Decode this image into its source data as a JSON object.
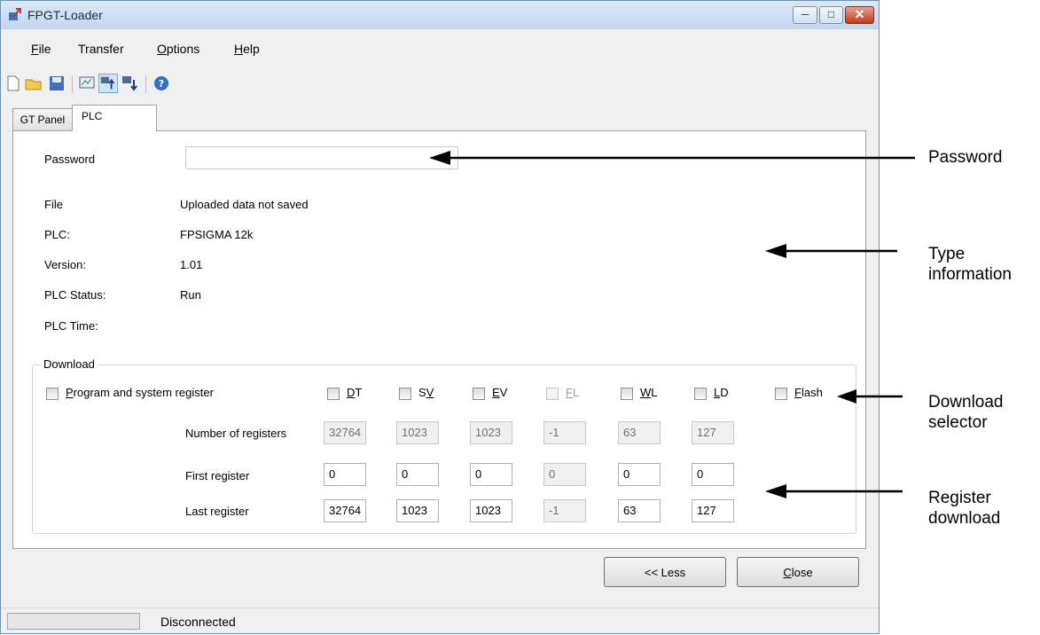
{
  "window": {
    "title": "FPGT-Loader"
  },
  "menu": [
    {
      "prefix": "",
      "accel": "F",
      "rest": "ile"
    },
    {
      "prefix": "Transfer",
      "accel": "",
      "rest": ""
    },
    {
      "prefix": "",
      "accel": "O",
      "rest": "ptions"
    },
    {
      "prefix": "",
      "accel": "H",
      "rest": "elp"
    }
  ],
  "tabs": {
    "gt_panel": "GT Panel",
    "plc": "PLC"
  },
  "password": {
    "label": "Password",
    "value": ""
  },
  "info": {
    "file_label": "File",
    "file_value": "Uploaded data not saved",
    "plc_label": "PLC:",
    "plc_value": "FPSIGMA 12k",
    "version_label": "Version:",
    "version_value": "1.01",
    "status_label": "PLC Status:",
    "status_value": "Run",
    "time_label": "PLC Time:",
    "time_value": ""
  },
  "download": {
    "title": "Download",
    "program": {
      "accel": "P",
      "rest": "rogram and system register",
      "checked": false
    },
    "row_labels": {
      "count": "Number of registers",
      "first": "First register",
      "last": "Last register"
    },
    "columns": [
      {
        "accel": "D",
        "rest": "T",
        "pre": "",
        "enabled": true,
        "count": "32764",
        "first": "0",
        "last": "32764"
      },
      {
        "accel": "V",
        "rest": "",
        "pre": "S",
        "enabled": true,
        "count": "1023",
        "first": "0",
        "last": "1023"
      },
      {
        "accel": "E",
        "rest": "V",
        "pre": "",
        "enabled": true,
        "count": "1023",
        "first": "0",
        "last": "1023"
      },
      {
        "accel": "F",
        "rest": "L",
        "pre": "",
        "enabled": false,
        "count": "-1",
        "first": "0",
        "last": "-1"
      },
      {
        "accel": "W",
        "rest": "L",
        "pre": "",
        "enabled": true,
        "count": "63",
        "first": "0",
        "last": "63"
      },
      {
        "accel": "L",
        "rest": "D",
        "pre": "",
        "enabled": true,
        "count": "127",
        "first": "0",
        "last": "127"
      }
    ],
    "flash": {
      "accel": "F",
      "rest": "lash"
    }
  },
  "buttons": {
    "less": "<< Less",
    "close_accel": "C",
    "close_rest": "lose"
  },
  "status": {
    "text": "Disconnected"
  },
  "annotations": {
    "password": "Password",
    "type_info_1": "Type",
    "type_info_2": "information",
    "download_selector_1": "Download",
    "download_selector_2": "selector",
    "register_download_1": "Register",
    "register_download_2": "download"
  }
}
